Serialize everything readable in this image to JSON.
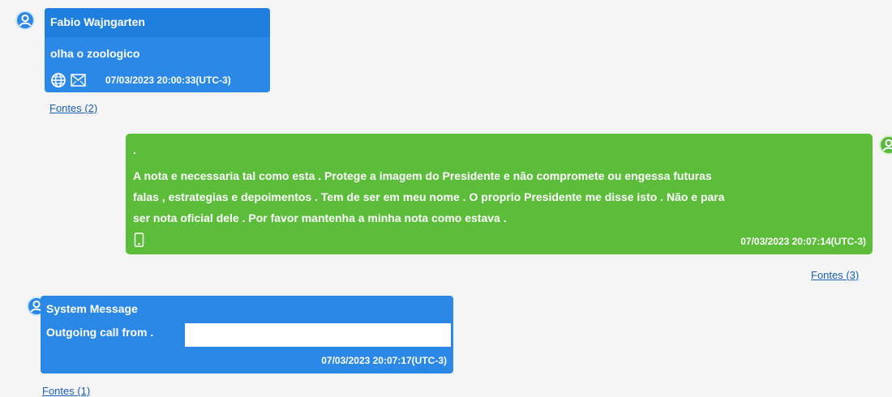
{
  "messages": [
    {
      "sender": "Fabio  Wajngarten",
      "text": "olha o zoologico",
      "timestamp": "07/03/2023 20:00:33(UTC-3)",
      "sources_label": "Fontes (2)",
      "icons": [
        "globe-icon",
        "mail-icon"
      ]
    },
    {
      "dot": ".",
      "line1": "A nota e necessaria tal como esta .   Protege a imagem do Presidente e não compromete ou engessa futuras",
      "line2": "falas ,  estrategias e depoimentos . Tem de ser em meu nome . O proprio Presidente me disse isto .   Não e para",
      "line3": "ser nota oficial dele .    Por favor mantenha a minha nota como estava .",
      "timestamp": "07/03/2023 20:07:14(UTC-3)",
      "sources_label": "Fontes (3)",
      "icons": [
        "phone-icon"
      ]
    },
    {
      "sender": "System Message",
      "text": "Outgoing call from .",
      "timestamp": "07/03/2023 20:07:17(UTC-3)",
      "sources_label": "Fontes (1)"
    }
  ],
  "colors": {
    "incoming": "#2b88e6",
    "outgoing": "#5bbd3a",
    "link": "#1a5fb4"
  }
}
